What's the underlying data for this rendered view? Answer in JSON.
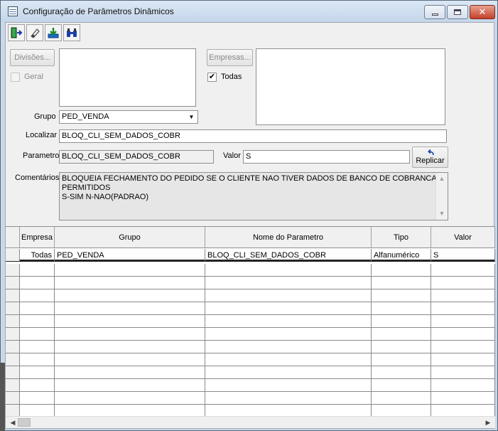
{
  "window": {
    "title": "Configuração de Parâmetros Dinâmicos"
  },
  "toolbar": {
    "buttons": [
      {
        "icon": "exit-door-icon",
        "label": "Sair"
      },
      {
        "icon": "eraser-icon",
        "label": "Limpar"
      },
      {
        "icon": "save-download-icon",
        "label": "Gravar"
      },
      {
        "icon": "binoculars-icon",
        "label": "Localizar"
      }
    ]
  },
  "form": {
    "divisoes_button": "Divisões...",
    "geral_label": "Geral",
    "geral_checked": false,
    "empresas_button": "Empresas...",
    "todas_label": "Todas",
    "todas_checked": true,
    "grupo_label": "Grupo",
    "grupo_value": "PED_VENDA",
    "localizar_label": "Localizar",
    "localizar_value": "BLOQ_CLI_SEM_DADOS_COBR",
    "parametro_label": "Parametro",
    "parametro_value": "BLOQ_CLI_SEM_DADOS_COBR",
    "valor_label": "Valor",
    "valor_value": "S",
    "replicar_button": "Replicar",
    "comentarios_label": "Comentários",
    "comentarios_lines": [
      "BLOQUEIA FECHAMENTO DO PEDIDO SE O CLIENTE NAO TIVER DADOS DE BANCO DE COBRANCA",
      "PERMITIDOS",
      "S-SIM N-NAO(PADRAO)"
    ]
  },
  "grid": {
    "columns": [
      "Empresa",
      "Grupo",
      "Nome do Parametro",
      "Tipo",
      "Valor"
    ],
    "rows": [
      {
        "empresa": "Todas",
        "grupo": "PED_VENDA",
        "nome": "BLOQ_CLI_SEM_DADOS_COBR",
        "tipo": "Alfanumérico",
        "valor": "S"
      }
    ]
  },
  "colors": {
    "title_bg": "#c9d9ea",
    "close_button": "#c4402a",
    "window_bg": "#f0f0f0"
  }
}
